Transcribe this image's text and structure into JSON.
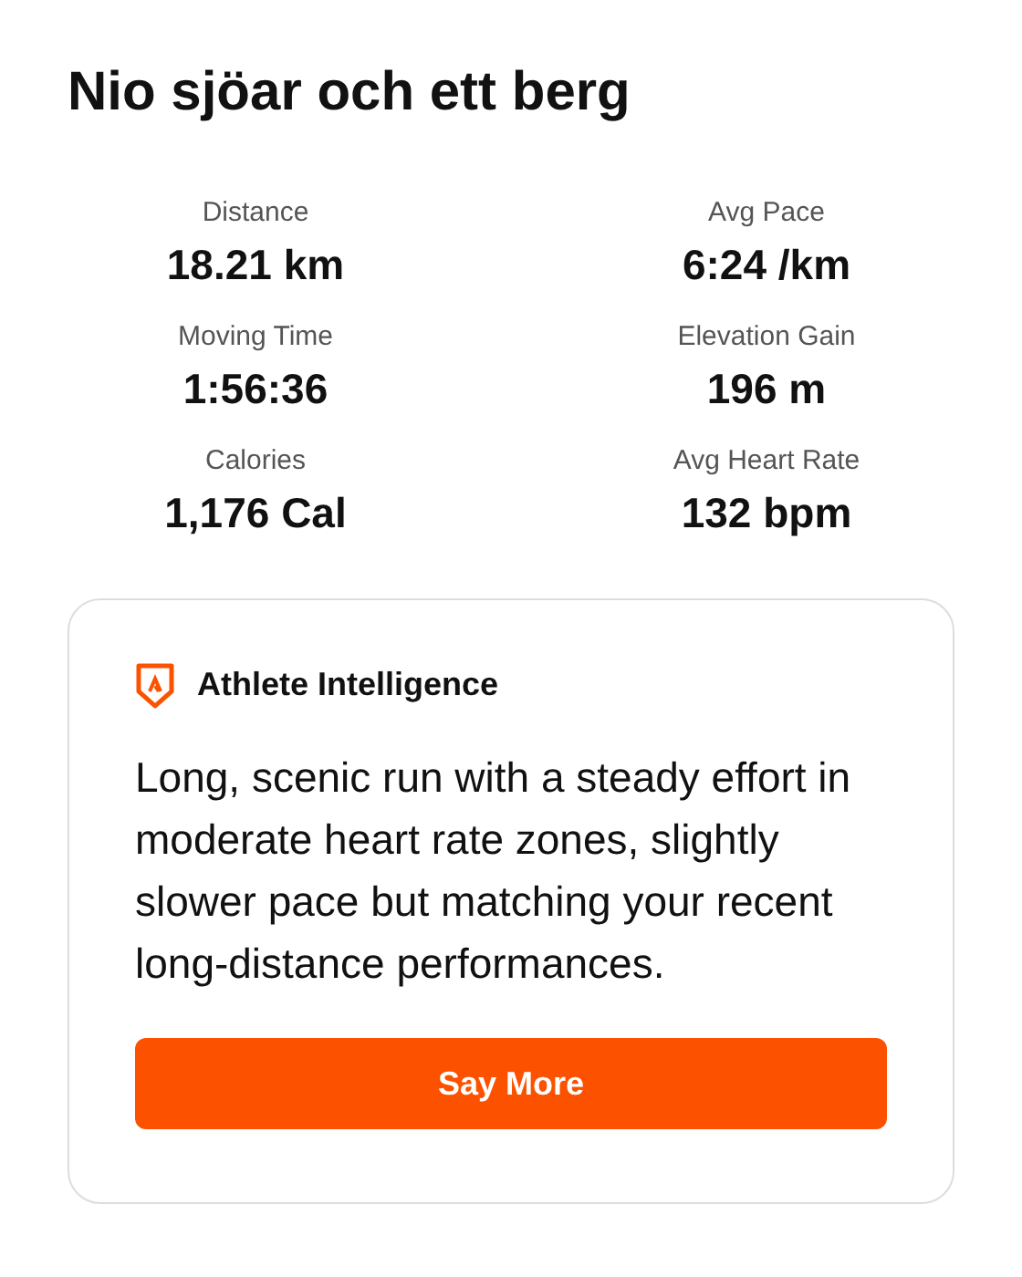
{
  "title": "Nio sjöar och ett berg",
  "stats": [
    {
      "label": "Distance",
      "value": "18.21 km"
    },
    {
      "label": "Avg Pace",
      "value": "6:24 /km"
    },
    {
      "label": "Moving Time",
      "value": "1:56:36"
    },
    {
      "label": "Elevation Gain",
      "value": "196 m"
    },
    {
      "label": "Calories",
      "value": "1,176 Cal"
    },
    {
      "label": "Avg Heart Rate",
      "value": "132 bpm"
    }
  ],
  "insight": {
    "heading": "Athlete Intelligence",
    "text": "Long, scenic run with a steady effort in moderate heart rate zones, slightly slower pace but matching your recent long-distance performances.",
    "button": "Say More"
  }
}
